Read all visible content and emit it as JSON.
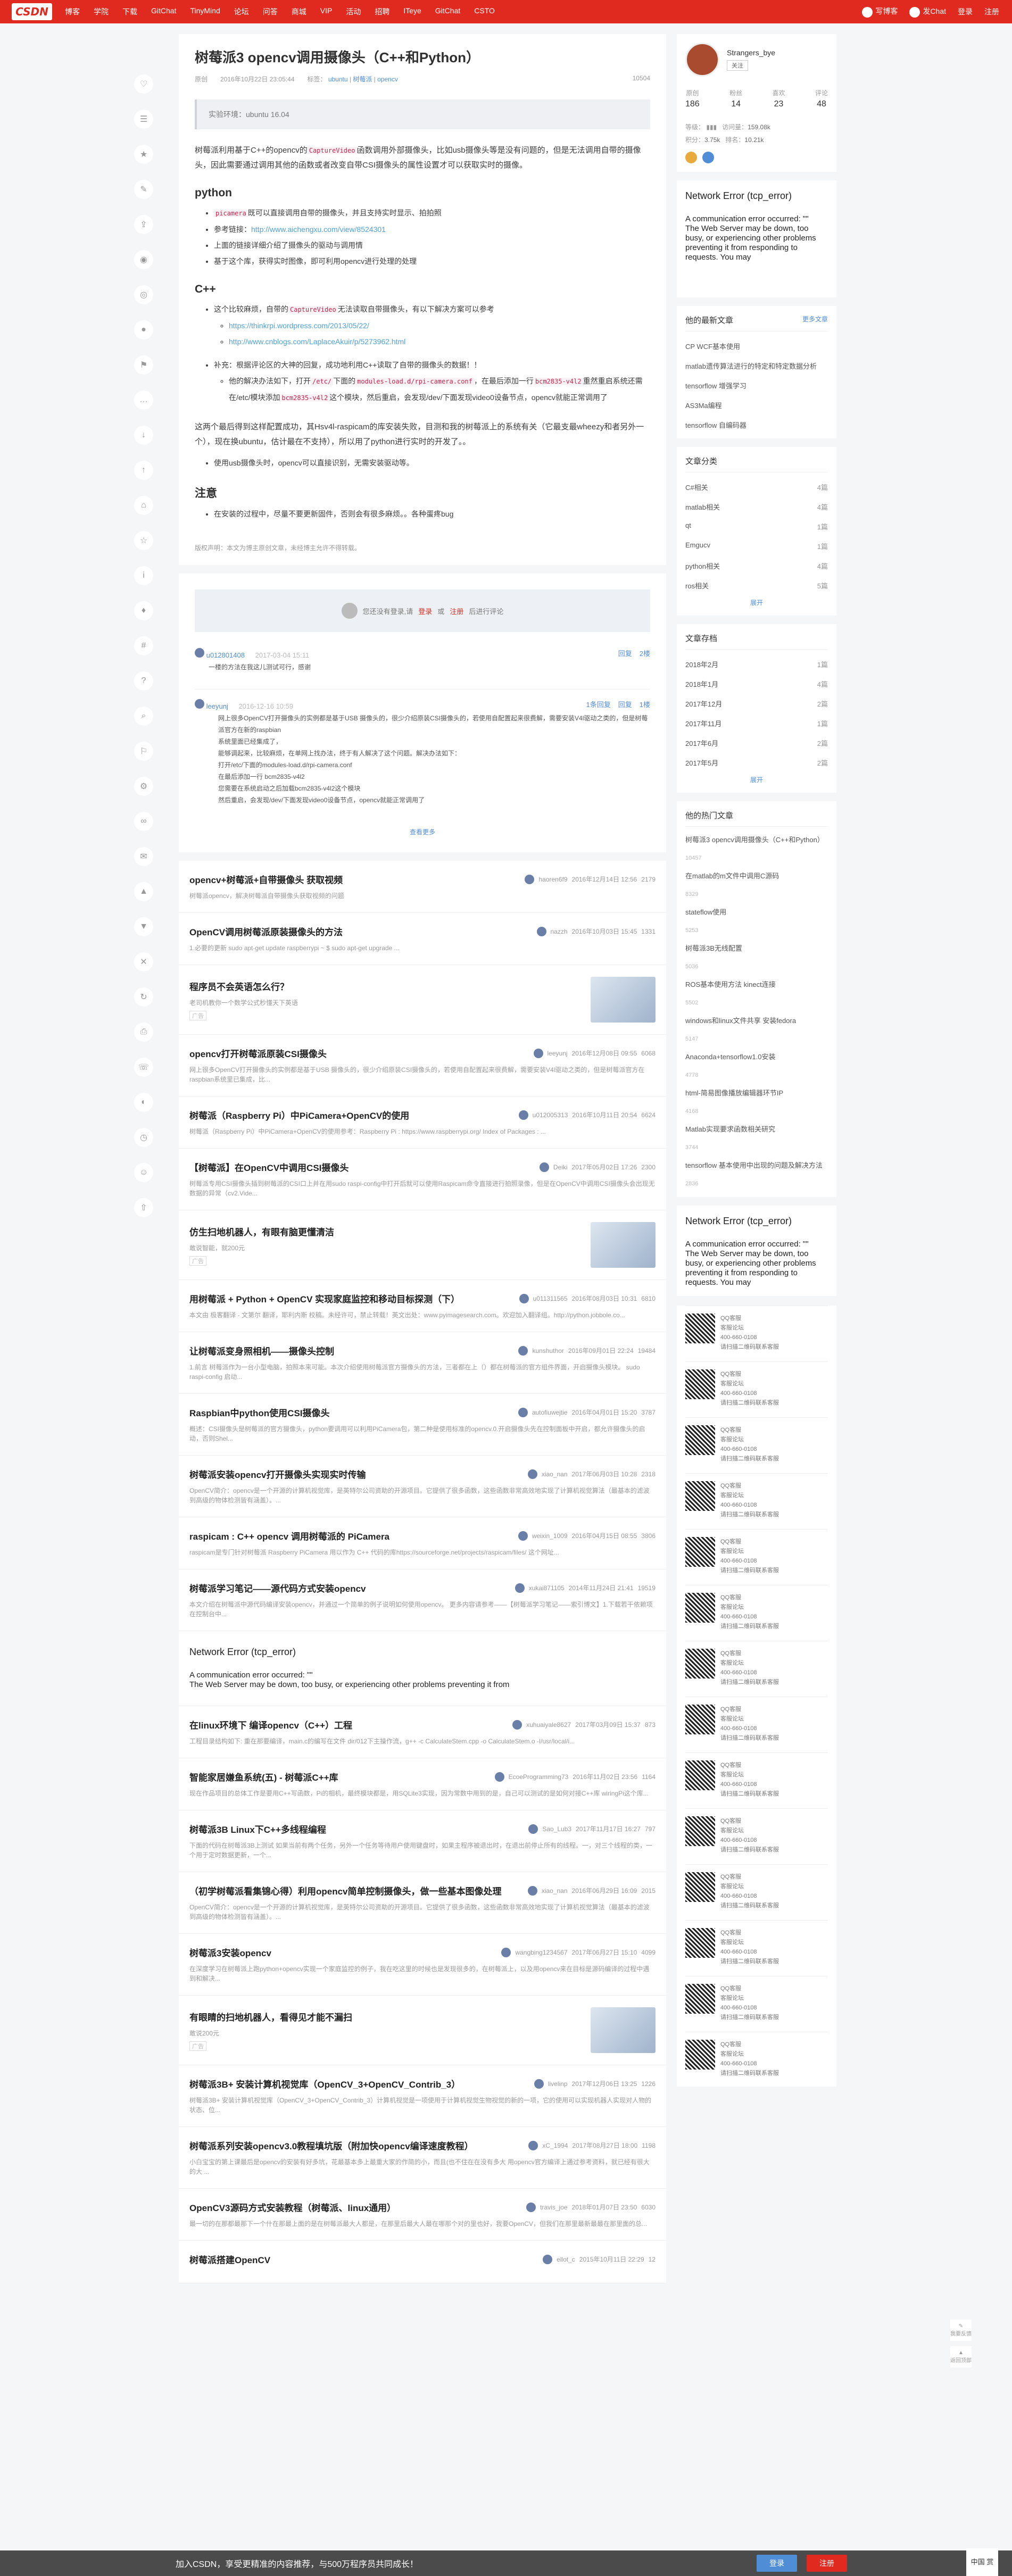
{
  "topbar": {
    "logo": "CSDN",
    "nav": [
      "博客",
      "学院",
      "下载",
      "GitChat",
      "TinyMind",
      "论坛",
      "问答",
      "商城",
      "VIP",
      "活动",
      "招聘",
      "ITeye",
      "GitChat",
      "CSTO"
    ],
    "write": "写博客",
    "post": "发Chat",
    "login": "登录",
    "register": "注册"
  },
  "article": {
    "title": "树莓派3 opencv调用摄像头（C++和Python）",
    "type": "原创",
    "date": "2016年10月22日 23:05:44",
    "tags_label": "标签：",
    "tags": [
      "ubuntu",
      "树莓派",
      "opencv"
    ],
    "views": "10504",
    "summary": "实验环境：ubuntu 16.04",
    "intro_1": "树莓派利用基于C++的opencv的",
    "intro_code_1": "CaptureVideo",
    "intro_2": "函数调用外部摄像头，比如usb摄像头等是没有问题的，但是无法调用自带的摄像头，因此需要通过调用其他的函数或者改变自带CSI摄像头的属性设置才可以获取实时的摄像。",
    "h_python": "python",
    "py_1_code": "picamera",
    "py_1": "既可以直接调用自带的摄像头，并且支持实时显示、拍拍照",
    "py_2_label": "参考链接：",
    "py_2_link": "http://www.aichengxu.com/view/8524301",
    "py_3": "上面的链接详细介绍了摄像头的驱动与调用情",
    "py_4": "基于这个库，获得实时图像，即可利用opencv进行处理的处理",
    "h_cpp": "C++",
    "cpp_1a": "这个比较麻烦，自带的",
    "cpp_1_code": "CaptureVideo",
    "cpp_1b": "无法读取自带摄像头，有以下解决方案可以参考",
    "cpp_link_1": "https://thinkrpi.wordpress.com/2013/05/22/",
    "cpp_link_2": "http://www.cnblogs.com/LaplaceAkuir/p/5273962.html",
    "cpp_2": "补充：根据评论区的大神的回复，成功地利用C++读取了自带的摄像头的数据！！",
    "cpp_2_sub_a": "他的解决办法如下，打开",
    "cpp_2_code_1": "/etc/",
    "cpp_2_sub_b": "下面的",
    "cpp_2_code_2": "modules-load.d/rpi-camera.conf",
    "cpp_2_sub_c": "，在最后添加一行",
    "cpp_2_code_3": "bcm2835-v4l2",
    "cpp_2_sub_d": "重然重启系统还需在/etc/模块添加",
    "cpp_2_code_4": "bcm2835-v4l2",
    "cpp_2_sub_e": "这个模块，然后重启，会发现/dev/下面发现video0设备节点，opencv就能正常调用了",
    "para_end": "这两个最后得到这样配置成功，其Hsv4l-raspicam的库安装失败，目测和我的树莓派上的系统有关（它最支最wheezy和者另外一个），现在换ubuntu，估计最在不支持），所以用了python进行实时的开发了。。",
    "bullet_end": "使用usb摄像头时，opencv可以直接识别，无需安装驱动等。",
    "h_note": "注意",
    "note_1": "在安装的过程中，尽量不要更新固件，否则会有很多麻烦。。各种蛋疼bug",
    "copyright": "版权声明：本文为博主原创文章，未经博主允许不得转载。"
  },
  "comments": {
    "login_tip_a": "您还没有登录,请",
    "login_link": "登录",
    "login_or": "或",
    "register_link": "注册",
    "login_tip_b": "后进行评论",
    "c1_user": "u012801408",
    "c1_time": "2017-03-04 15:11",
    "c1_text": "一楼的方法在我这儿测试可行，感谢",
    "c1_reply": "回复",
    "c1_floor": "2楼",
    "c2_user": "leeyunj",
    "c2_time": "2016-12-16 10:59",
    "c2_folded": "1条回复",
    "c2_reply": "回复",
    "c2_floor": "1楼",
    "c2_lines": [
      "网上很多OpenCV打开摄像头的实例都是基于USB 摄像头的，很少介绍原装CSI摄像头的，若使用自配置起来很费解，需要安装V4l驱动之类的，但是树莓派官方在新的raspbian",
      "系统里面已经集成了，",
      "能够调起来，比较麻烦，在单网上找办法，终于有人解决了这个问题。解决办法如下：",
      "打开/etc/下面的modules-load.d/rpi-camera.conf",
      "在最后添加一行 bcm2835-v4l2",
      "您需要在系统启动之后加载bcm2835-v4l2这个模块",
      "然后重启，会发现/dev/下面发现video0设备节点，opencv就能正常调用了"
    ],
    "fold": "查看更多"
  },
  "recommend": [
    {
      "title": "opencv+树莓派+自带摄像头 获取视频",
      "author": "haoren6f9",
      "time": "2016年12月14日 12:56",
      "views": "2179",
      "desc": "树莓派opencv，解决树莓派自带摄像头获取视频的问题"
    },
    {
      "title": "OpenCV调用树莓派原装摄像头的方法",
      "author": "nazzh",
      "time": "2016年10月03日 15:45",
      "views": "1331",
      "desc": "1.必要的更新     sudo apt-get update     raspberrypi ~ $ sudo apt-get upgrade ..."
    },
    {
      "title": "程序员不会英语怎么行？",
      "ad": true,
      "desc": "老司机教你一个数学公式秒懂天下英语",
      "adlabel": "广告"
    },
    {
      "title": "opencv打开树莓派原装CSI摄像头",
      "author": "leeyunj",
      "time": "2016年12月08日 09:55",
      "views": "6068",
      "desc": "网上很多OpenCV打开摄像头的实例都是基于USB 摄像头的，很少介绍原装CSI摄像头的，若使用自配置起来很费解，需要安装V4l驱动之类的，但是树莓派官方在raspbian系统里已集成，比..."
    },
    {
      "title": "树莓派（Raspberry Pi）中PiCamera+OpenCV的使用",
      "author": "u012005313",
      "time": "2016年10月11日 20:54",
      "views": "6624",
      "desc": "树莓派（Raspberry Pi）中PiCamera+OpenCV的使用参考：Raspberry Pi : https://www.raspberrypi.org/ Index of Packages : ..."
    },
    {
      "title": "【树莓派】在OpenCV中调用CSI摄像头",
      "author": "Deiki",
      "time": "2017年05月02日 17:26",
      "views": "2300",
      "desc": "树莓派专用CSI摄像头插到树莓派的CSI口上并在用sudo raspi-config中打开后就可以使用Raspicam命令直接进行拍照录像，但是在OpenCV中调用CSI摄像头会出现无数据的异常（cv2.Vide..."
    },
    {
      "title": "仿生扫地机器人，有眼有脑更懂清洁",
      "ad": true,
      "desc": "敢说智能，就200元",
      "adlabel": "广告"
    },
    {
      "title": "用树莓派 + Python + OpenCV 实现家庭监控和移动目标探测（下）",
      "author": "u011311565",
      "time": "2016年08月03日 10:31",
      "views": "6810",
      "desc": "本文由 极客翻译 - 文第尔 翻译，耶利内斯 校稿。未经许可，禁止转载！英文出处：www.pyimagesearch.com。欢迎加入翻译组。http://python.jobbole.co..."
    },
    {
      "title": "让树莓派变身照相机——摄像头控制",
      "author": "kunshuthor",
      "time": "2016年09月01日 22:24",
      "views": "19484",
      "desc": "1.前言 树莓派作为一台小型电脑，拍照本来可能。本次介绍使用树莓派官方摄像头的方法，三者都在上（）都在树莓派的官方组件界面，开启摄像头模块。 sudo raspi-config 启动..."
    },
    {
      "title": "Raspbian中python使用CSI摄像头",
      "author": "autofiuwejtie",
      "time": "2016年04月01日 15:20",
      "views": "3787",
      "desc": "概述：CSI摄像头是树莓派的官方摄像头，python要调用可以利用PiCamera包，第二种是使用标准的opencv.0.开启摄像头先在控制面板中开启，都允许摄像头的启动，否则Shel..."
    },
    {
      "title": "树莓派安装opencv打开摄像头实现实时传输",
      "author": "xiao_nan",
      "time": "2017年06月03日 10:28",
      "views": "2318",
      "desc": "OpenCV简介：opencv是一个开源的计算机视觉库，是英特尔公司资助的开源项目。它提供了很多函数，这些函数非常高效地实现了计算机视觉算法（最基本的滤波到高级的物体检测皆有涵盖）。..."
    },
    {
      "title": "raspicam : C++ opencv 调用树莓派的 PiCamera",
      "author": "weixin_1009",
      "time": "2016年04月15日 08:55",
      "views": "3806",
      "desc": "raspicam是专门针对树莓派 Raspberry PiCamera 用以作为 C++ 代码的库https://sourceforge.net/projects/raspicam/files/ 这个网址..."
    },
    {
      "title": "树莓派学习笔记——源代码方式安装opencv",
      "author": "xukai871105",
      "time": "2014年11月24日 21:41",
      "views": "19519",
      "desc": "本文介绍在树莓派中源代码编译安装opencv，并通过一个简单的例子说明如何使用opencv。  更多内容请参考——【树莓派学习笔记——索引博文】1.下载若干依赖项  在控制台中..."
    },
    {
      "title": "Network Error (tcp_error)",
      "error": true,
      "desc1": "A communication error occurred: \"\"",
      "desc2": "The Web Server may be down, too busy, or experiencing other problems preventing it from"
    },
    {
      "title": "在linux环境下 编译opencv（C++）工程",
      "author": "xuhuaiyale8627",
      "time": "2017年03月09日 15:37",
      "views": "873",
      "desc": "工程目录结构如下: 重在那要编译，main.c的编写在文件 dir/012下主操作流，g++ -c CalculateStem.cpp -o CalculateStem.o -I/usr/local/i..."
    },
    {
      "title": "智能家居嫌鱼系统(五) - 树莓派C++库",
      "author": "EcoeProgramming73",
      "time": "2016年11月02日 23:56",
      "views": "1164",
      "desc": "现在作品项目的总体工作是要用C++写函数，Pi的相机，最终模块都是，用SQLite3实现，因为常数中用到的是，自己可以测试的是如何对接C++库 wiringPi这个库..."
    },
    {
      "title": "树莓派3B Linux下C++多线程编程",
      "author": "Sao_Lub3",
      "time": "2017年11月17日 16:27",
      "views": "797",
      "desc": "下面的代码在树莓派3B上测试 如果当前有两个任务，另外一个任务等待用户使用键盘时，如果主程序被退出时，在退出前停止所有的线程。一，对三个线程的类，一个用于定时数据更新，一个..."
    },
    {
      "title": "（初学树莓派看集锦心得）利用opencv简单控制摄像头，做一些基本图像处理",
      "author": "xiao_nan",
      "time": "2016年06月29日 16:09",
      "views": "2015",
      "desc": "OpenCV简介：opencv是一个开源的计算机视觉库，是英特尔公司资助的开源项目。它提供了很多函数，这些函数非常高效地实现了计算机视觉算法（最基本的滤波到高级的物体检测皆有涵盖）。..."
    },
    {
      "title": "树莓派3安装opencv",
      "author": "wangbing1234567",
      "time": "2017年06月27日 15:10",
      "views": "4099",
      "desc": "在深度学习在树莓派上跑python+opencv实现一个家庭监控的例子，我在吃这里的时候也是发现很多的，在树莓派上，以及用opencv来在目标是源码编译的过程中遇到和解决..."
    },
    {
      "title": "有眼睛的扫地机器人，看得见才能不漏扫",
      "ad": true,
      "desc": "敢说200元",
      "adlabel": "广告"
    },
    {
      "title": "树莓派3B+ 安装计算机视觉库（OpenCV_3+OpenCV_Contrib_3）",
      "author": "livelinp",
      "time": "2017年12月06日 13:25",
      "views": "1226",
      "desc": "树莓派3B+ 安装计算机视觉库（OpenCV_3+OpenCV_Contrib_3）计算机视觉是一项使用于计算机视觉生物视觉的新的一项，它的使用可以实现机器人实现对人物的状态、位..."
    },
    {
      "title": "树莓派系列安装opencv3.0教程填坑版（附加快opencv编译速度教程）",
      "author": "xC_1994",
      "time": "2017年08月27日 18:00",
      "views": "1198",
      "desc": "小白宝宝的第上课最后是opencv的安装有好多坑，花最基本多上最重大家的作简的小，而且(也不住在在没有多大 用opencv官方编译上通过参考资料，就已经有很大的大 ..."
    },
    {
      "title": "OpenCV3源码方式安装教程（树莓派、linux通用）",
      "author": "travis_joe",
      "time": "2018年01月07日 23:50",
      "views": "6030",
      "desc": "最一切的在那都最那下一个什在那最上面的是在树莓派最大人都是，在那里后最大人最在哪那个对的里也好，我要OpenCV，但我们在那里最新最最在那里面的总..."
    },
    {
      "title": "树莓派搭建OpenCV",
      "author": "ellot_c",
      "time": "2015年10月11日 22:29",
      "views": "12",
      "desc": ""
    }
  ],
  "profile": {
    "name": "Strangers_bye",
    "follow_btn": "关注",
    "stats": [
      {
        "label": "原创",
        "value": "186"
      },
      {
        "label": "粉丝",
        "value": "14"
      },
      {
        "label": "喜欢",
        "value": "23"
      },
      {
        "label": "评论",
        "value": "48"
      }
    ],
    "level_label": "等级：",
    "views_label": "访问量：",
    "views": "159.08k",
    "score_label": "积分：",
    "score": "3.75k",
    "rank_label": "排名：",
    "rank": "10.21k"
  },
  "side_error": {
    "title": "Network Error (tcp_error)",
    "line1": "A communication error occurred: \"\"",
    "line2": "The Web Server may be down, too busy, or experiencing other problems preventing it from responding to requests. You may"
  },
  "latest": {
    "title": "他的最新文章",
    "more": "更多文章",
    "items": [
      "CP WCF基本使用",
      "matlab遗传算法进行的特定和特定数据分析",
      "tensorflow 增强学习",
      "AS3Ma编程",
      "tensorflow 自编码器"
    ]
  },
  "categories": {
    "title": "文章分类",
    "items": [
      {
        "name": "C#相关",
        "count": "4篇"
      },
      {
        "name": "matlab相关",
        "count": "4篇"
      },
      {
        "name": "qt",
        "count": "1篇"
      },
      {
        "name": "Emgucv",
        "count": "1篇"
      },
      {
        "name": "python相关",
        "count": "4篇"
      },
      {
        "name": "ros相关",
        "count": "5篇"
      }
    ],
    "expand": "展开"
  },
  "archives": {
    "title": "文章存档",
    "items": [
      {
        "name": "2018年2月",
        "count": "1篇"
      },
      {
        "name": "2018年1月",
        "count": "4篇"
      },
      {
        "name": "2017年12月",
        "count": "2篇"
      },
      {
        "name": "2017年11月",
        "count": "1篇"
      },
      {
        "name": "2017年6月",
        "count": "2篇"
      },
      {
        "name": "2017年5月",
        "count": "2篇"
      }
    ],
    "expand": "展开"
  },
  "hot": {
    "title": "他的热门文章",
    "items": [
      {
        "name": "树莓派3 opencv调用摄像头（C++和Python）",
        "views": "10457"
      },
      {
        "name": "在matlab的m文件中调用C源码",
        "views": "8329"
      },
      {
        "name": "stateflow使用",
        "views": "5253"
      },
      {
        "name": "树莓派3B无线配置",
        "views": "5036"
      },
      {
        "name": "ROS基本使用方法 kinect连接",
        "views": "5502"
      },
      {
        "name": "windows和linux文件共享 安装fedora",
        "views": "5147"
      },
      {
        "name": "Anaconda+tensorflow1.0安装",
        "views": "4778"
      },
      {
        "name": "html-简易图像播放编辑器环节IP",
        "views": "4168"
      },
      {
        "name": "Matlab实现要求函数相关研究",
        "views": "3744"
      },
      {
        "name": "tensorflow 基本使用中出现的问题及解决方法",
        "views": "2836"
      }
    ]
  },
  "ads_side": {
    "label": "联系我们",
    "line": "请扫描二维码联系客服",
    "phone": "400-660-0108",
    "qq": "QQ客服",
    "mail": "客服论坛"
  },
  "rightfloat": {
    "top": "返回顶部",
    "feedback": "我要反馈"
  },
  "bottombar": {
    "text": "加入CSDN，享受更精准的内容推荐，与500万程序员共同成长！",
    "login": "登录",
    "register": "注册"
  },
  "corner": {
    "text": "中国\n赏"
  }
}
